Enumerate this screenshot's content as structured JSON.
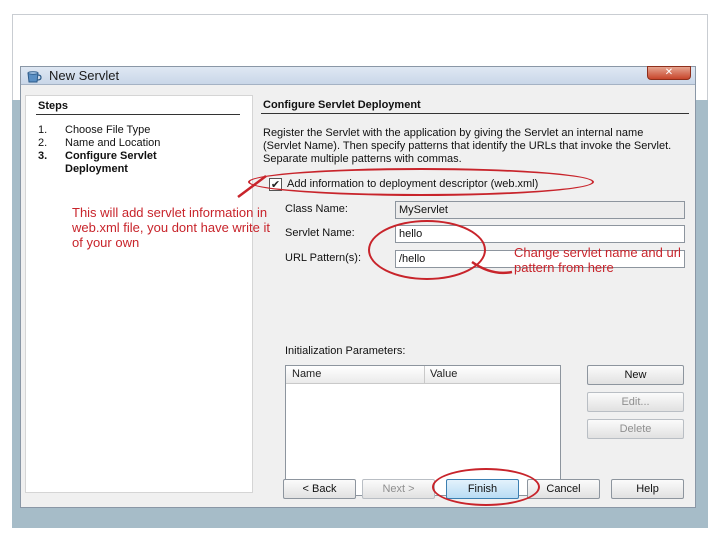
{
  "window": {
    "title": "New Servlet",
    "close_glyph": "✕"
  },
  "steps": {
    "header": "Steps",
    "items": [
      {
        "num": "1.",
        "label": "Choose File Type"
      },
      {
        "num": "2.",
        "label": "Name and Location"
      },
      {
        "num": "3.",
        "label": "Configure Servlet Deployment"
      }
    ]
  },
  "content": {
    "title": "Configure Servlet Deployment",
    "description": "Register the Servlet with the application by giving the Servlet an internal name (Servlet Name). Then specify patterns that identify the URLs that invoke the Servlet. Separate multiple patterns with commas.",
    "checkbox": {
      "label": "Add information to deployment descriptor (web.xml)",
      "checked": true,
      "glyph": "✔"
    },
    "fields": {
      "class_name_label": "Class Name:",
      "class_name_value": "MyServlet",
      "servlet_name_label": "Servlet Name:",
      "servlet_name_value": "hello",
      "url_pattern_label": "URL Pattern(s):",
      "url_pattern_value": "/hello"
    },
    "params": {
      "label": "Initialization Parameters:",
      "columns": [
        "Name",
        "Value"
      ]
    },
    "side_buttons": {
      "new": "New",
      "edit": "Edit...",
      "delete": "Delete"
    }
  },
  "buttons": {
    "back": "< Back",
    "next": "Next >",
    "finish": "Finish",
    "cancel": "Cancel",
    "help": "Help"
  },
  "annotations": {
    "deployment_note": "This will add servlet information in web.xml file, you dont have write it of your own",
    "rename_note": "Change servlet name and url pattern from here",
    "color": "#c8242b"
  },
  "icons": {
    "window": "coffee-cup-icon",
    "close": "close-icon",
    "checkbox": "checkmark-icon"
  }
}
